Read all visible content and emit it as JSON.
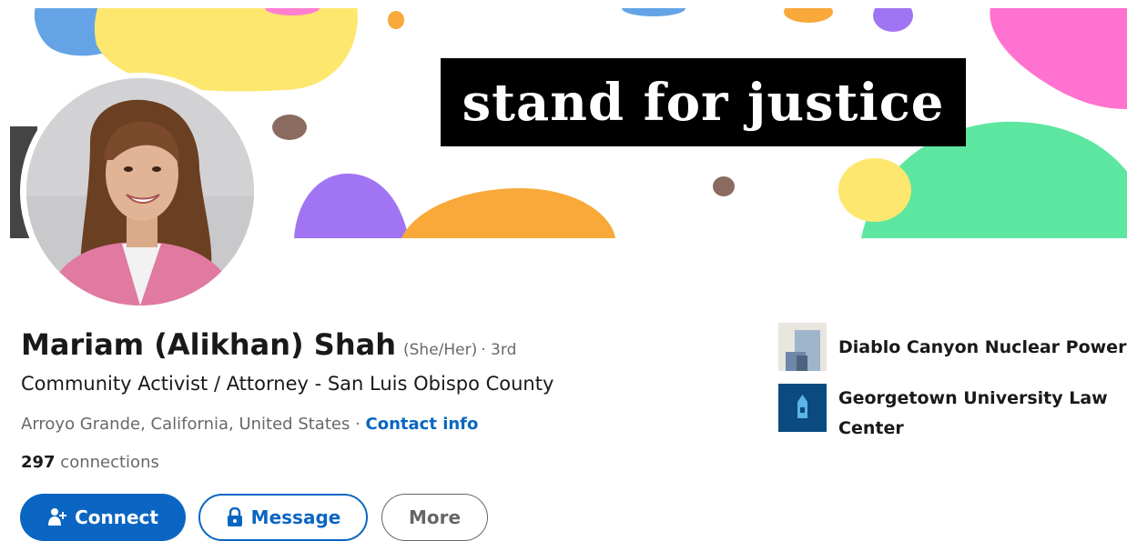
{
  "profile": {
    "banner_text": "stand for justice",
    "name": "Mariam (Alikhan) Shah",
    "pronouns": "(She/Her)",
    "degree": "· 3rd",
    "headline": "Community Activist / Attorney - San Luis Obispo County",
    "location": "Arroyo Grande, California, United States",
    "separator": " · ",
    "contact_info_label": "Contact info",
    "connections_count": "297",
    "connections_label": " connections"
  },
  "actions": {
    "connect_label": "Connect",
    "message_label": "Message",
    "more_label": "More"
  },
  "organizations": [
    {
      "name": "Diablo Canyon Nuclear Power",
      "icon": "company-logo"
    },
    {
      "name": "Georgetown University Law Center",
      "icon": "school-logo"
    }
  ],
  "colors": {
    "linkedin_blue": "#0a66c2",
    "text_primary": "rgba(0,0,0,0.9)",
    "text_secondary": "rgba(0,0,0,0.6)"
  }
}
